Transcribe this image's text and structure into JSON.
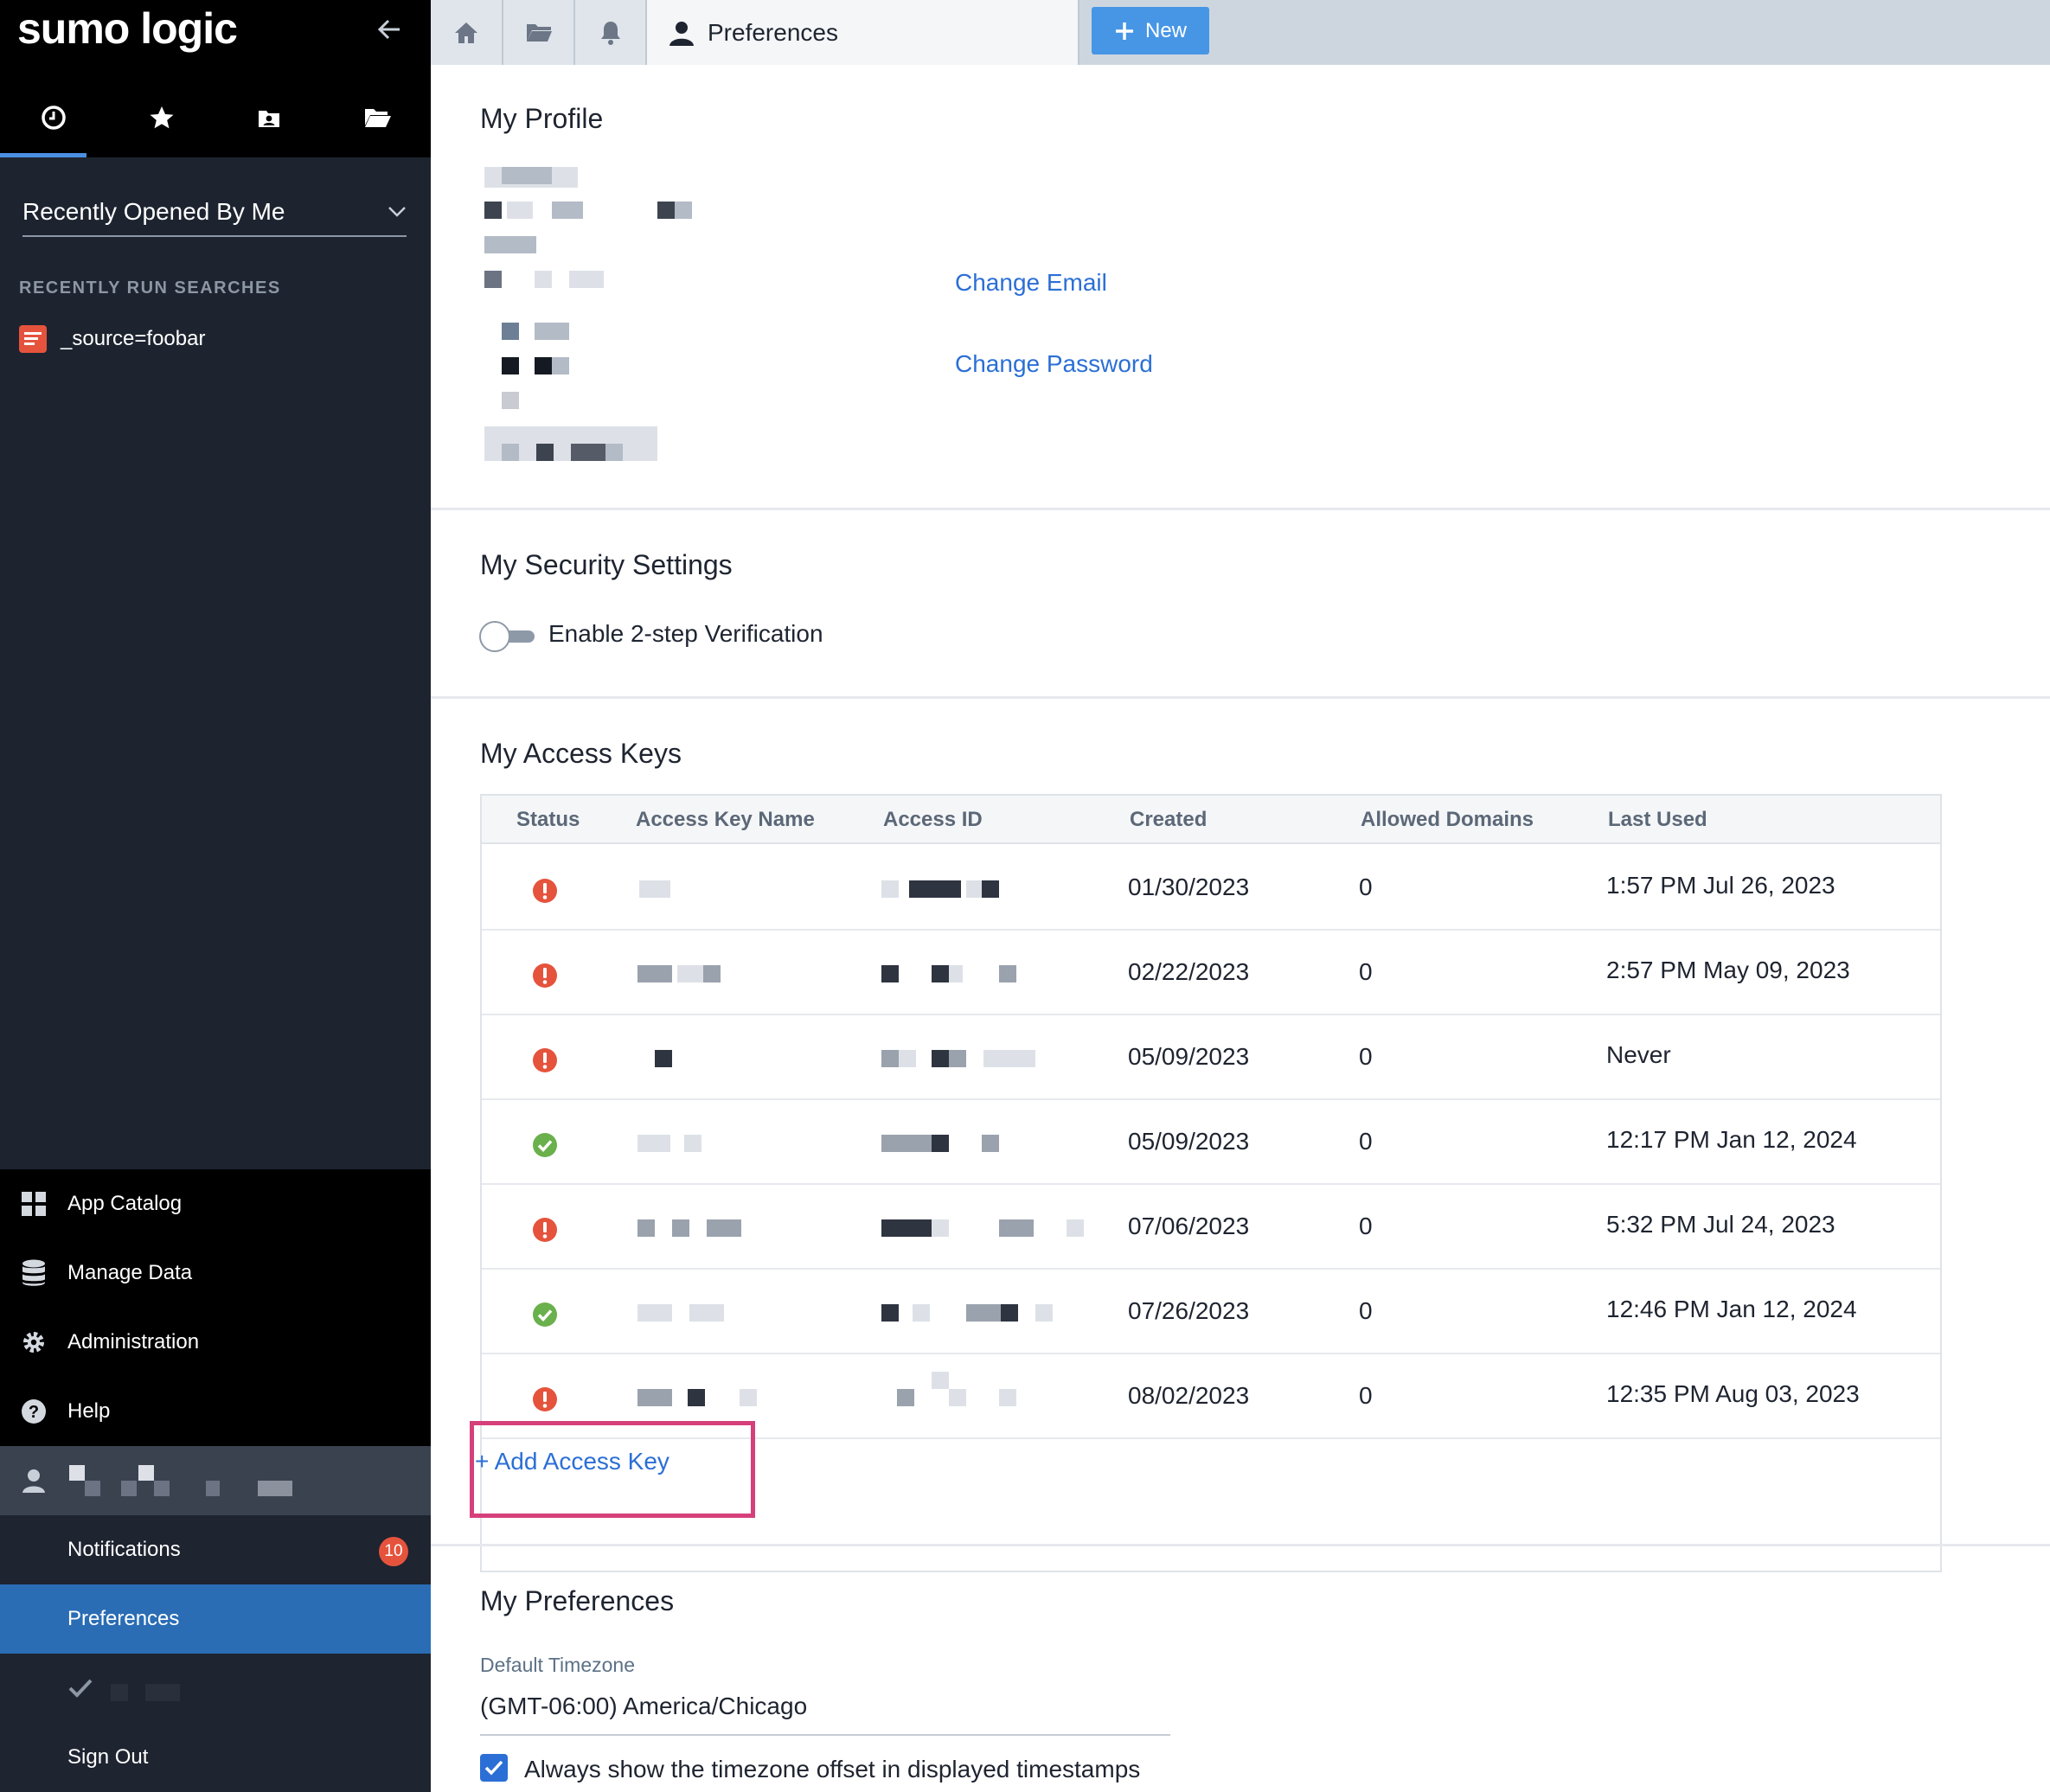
{
  "app": {
    "logo_text": "sumo logic"
  },
  "sidebar": {
    "tab_icons": [
      "clock-icon",
      "star-icon",
      "contacts-icon",
      "folder-open-icon"
    ],
    "dropdown_label": "Recently Opened By Me",
    "recent_section_title": "RECENTLY RUN SEARCHES",
    "recent_items": [
      {
        "label": "_source=foobar",
        "icon": "search-doc-icon"
      }
    ],
    "nav_items": [
      {
        "label": "App Catalog",
        "icon": "grid-icon"
      },
      {
        "label": "Manage Data",
        "icon": "database-icon"
      },
      {
        "label": "Administration",
        "icon": "gear-icon"
      },
      {
        "label": "Help",
        "icon": "help-icon"
      }
    ],
    "notifications_label": "Notifications",
    "notifications_count": "10",
    "preferences_label": "Preferences",
    "signout_label": "Sign Out"
  },
  "topbar": {
    "tab_icons": [
      "home-icon",
      "folder-icon",
      "bell-icon"
    ],
    "active_tab_label": "Preferences",
    "new_button_label": "New"
  },
  "profile": {
    "title": "My Profile",
    "change_email": "Change Email",
    "change_password": "Change Password"
  },
  "security": {
    "title": "My Security Settings",
    "two_step_label": "Enable 2-step Verification",
    "two_step_enabled": false
  },
  "access_keys": {
    "title": "My Access Keys",
    "columns": [
      "Status",
      "Access Key Name",
      "Access ID",
      "Created",
      "Allowed Domains",
      "Last Used"
    ],
    "rows": [
      {
        "status": "error",
        "created": "01/30/2023",
        "domains": "0",
        "last_used": "1:57 PM Jul 26, 2023"
      },
      {
        "status": "error",
        "created": "02/22/2023",
        "domains": "0",
        "last_used": "2:57 PM May 09, 2023"
      },
      {
        "status": "error",
        "created": "05/09/2023",
        "domains": "0",
        "last_used": "Never"
      },
      {
        "status": "ok",
        "created": "05/09/2023",
        "domains": "0",
        "last_used": "12:17 PM Jan 12, 2024"
      },
      {
        "status": "error",
        "created": "07/06/2023",
        "domains": "0",
        "last_used": "5:32 PM Jul 24, 2023"
      },
      {
        "status": "ok",
        "created": "07/26/2023",
        "domains": "0",
        "last_used": "12:46 PM Jan 12, 2024"
      },
      {
        "status": "error",
        "created": "08/02/2023",
        "domains": "0",
        "last_used": "12:35 PM Aug 03, 2023"
      }
    ],
    "add_button_label": "+ Add Access Key"
  },
  "preferences": {
    "title": "My Preferences",
    "timezone_label": "Default Timezone",
    "timezone_value": "(GMT-06:00) America/Chicago",
    "show_offset_label": "Always show the timezone offset in displayed timestamps",
    "show_offset_checked": true
  },
  "colors": {
    "accent": "#2b6fd6",
    "error": "#e5533c",
    "ok": "#6ab04c",
    "highlight": "#d6407a"
  }
}
